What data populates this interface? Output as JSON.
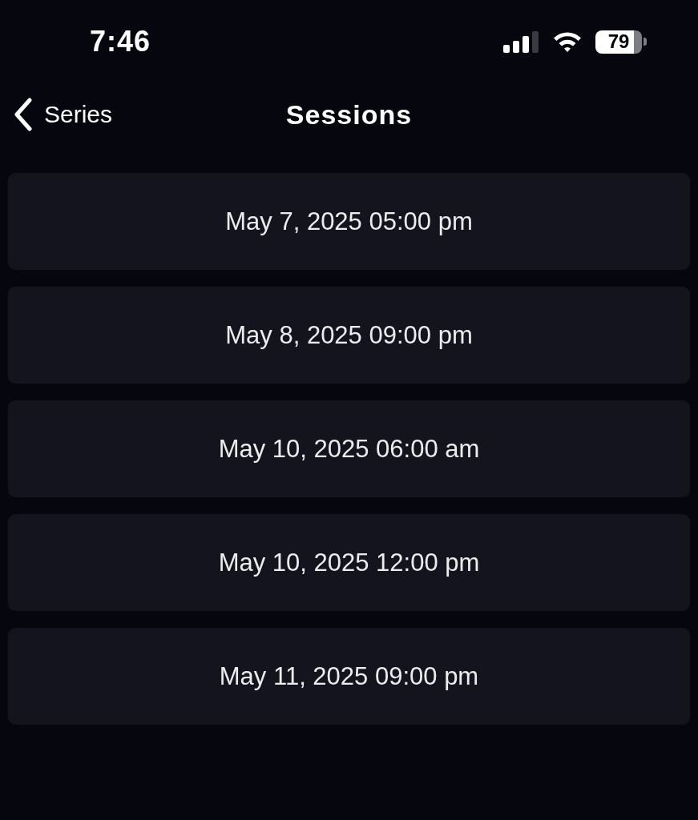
{
  "status_bar": {
    "time": "7:46",
    "battery": "79"
  },
  "nav_bar": {
    "back_label": "Series",
    "title": "Sessions"
  },
  "sessions": [
    {
      "label": "May 7, 2025 05:00 pm"
    },
    {
      "label": "May 8, 2025 09:00 pm"
    },
    {
      "label": "May 10, 2025 06:00 am"
    },
    {
      "label": "May 10, 2025 12:00 pm"
    },
    {
      "label": "May 11, 2025 09:00 pm"
    }
  ]
}
